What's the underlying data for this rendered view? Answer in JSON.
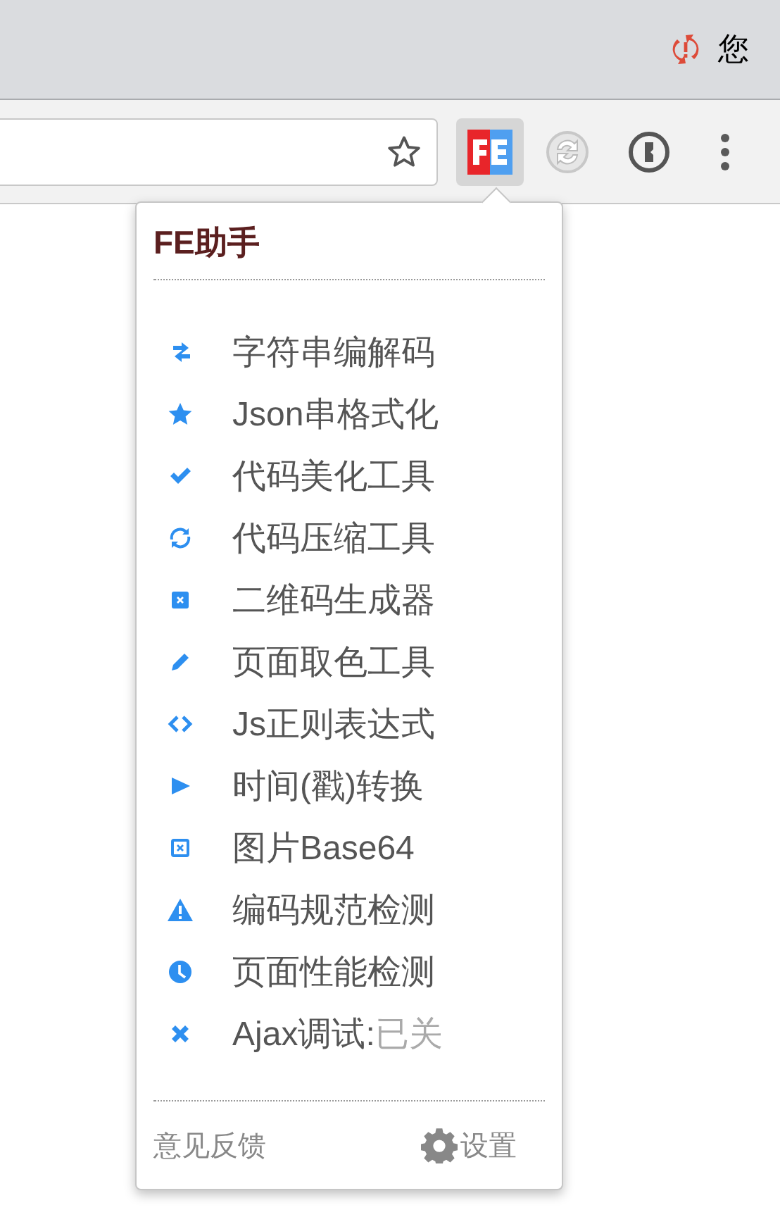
{
  "profile": {
    "name": "您",
    "sync_error": true
  },
  "toolbar": {
    "extension_selected": true
  },
  "popup": {
    "title": "FE助手",
    "items": [
      {
        "label": "字符串编解码"
      },
      {
        "label": "Json串格式化"
      },
      {
        "label": "代码美化工具"
      },
      {
        "label": "代码压缩工具"
      },
      {
        "label": "二维码生成器"
      },
      {
        "label": "页面取色工具"
      },
      {
        "label": "Js正则表达式"
      },
      {
        "label": "时间(戳)转换"
      },
      {
        "label": "图片Base64"
      },
      {
        "label": "编码规范检测"
      },
      {
        "label": "页面性能检测"
      },
      {
        "label": "Ajax调试:",
        "status": "已关",
        "on": false
      }
    ],
    "footer": {
      "feedback": "意见反馈",
      "settings": "设置"
    }
  }
}
